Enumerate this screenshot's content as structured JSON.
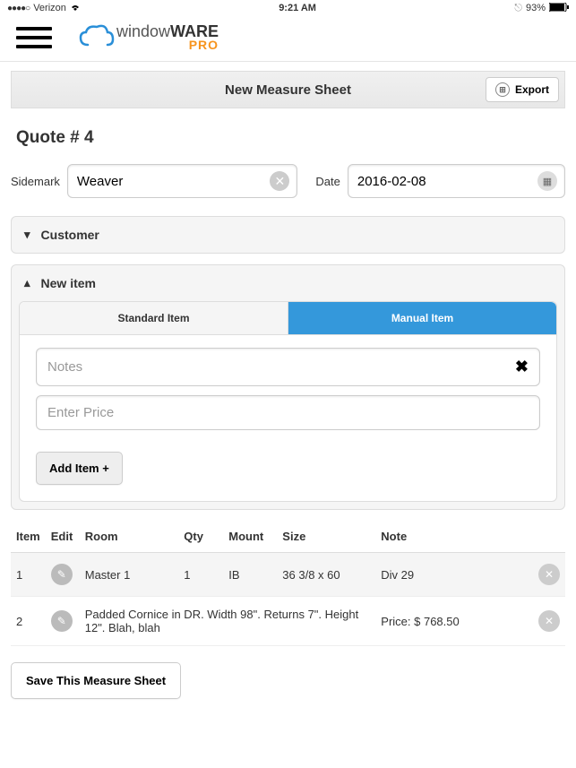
{
  "status": {
    "carrier": "Verizon",
    "time": "9:21 AM",
    "battery": "93%"
  },
  "logo": {
    "word1": "window",
    "word2": "WARE",
    "word3": "PRO"
  },
  "titlebar": {
    "title": "New Measure Sheet",
    "export": "Export"
  },
  "quote": {
    "heading": "Quote # 4"
  },
  "form": {
    "sidemark_label": "Sidemark",
    "sidemark_value": "Weaver",
    "date_label": "Date",
    "date_value": "2016-02-08"
  },
  "customer": {
    "label": "Customer"
  },
  "newitem": {
    "label": "New item",
    "tab_standard": "Standard Item",
    "tab_manual": "Manual Item",
    "notes_placeholder": "Notes",
    "price_placeholder": "Enter Price",
    "add_label": "Add Item +"
  },
  "table": {
    "headers": {
      "item": "Item",
      "edit": "Edit",
      "room": "Room",
      "qty": "Qty",
      "mount": "Mount",
      "size": "Size",
      "note": "Note"
    },
    "rows": [
      {
        "item": "1",
        "room": "Master 1",
        "qty": "1",
        "mount": "IB",
        "size": "36 3/8 x 60",
        "note": "Div 29"
      },
      {
        "item": "2",
        "room": "Padded Cornice in DR. Width 98\". Returns 7\". Height 12\". Blah, blah",
        "qty": "",
        "mount": "",
        "size": "",
        "note": "Price: $ 768.50"
      }
    ]
  },
  "save": {
    "label": "Save This Measure Sheet"
  }
}
